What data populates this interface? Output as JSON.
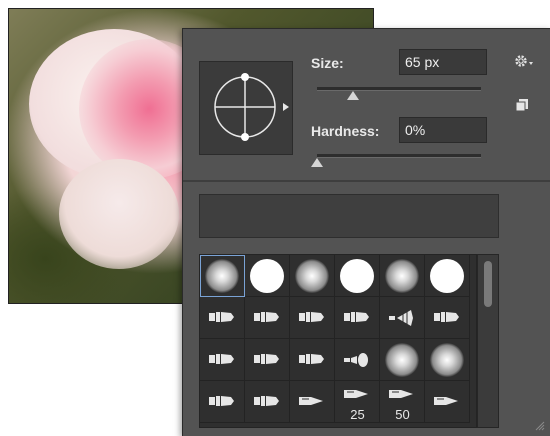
{
  "brush_panel": {
    "size_label": "Size:",
    "size_value": "65 px",
    "size_slider_fraction": 0.22,
    "hardness_label": "Hardness:",
    "hardness_value": "0%",
    "hardness_slider_fraction": 0.0,
    "icons": {
      "settings": "gear-icon",
      "new_preset": "new-preset-icon",
      "preview": "brush-tip-preview-icon",
      "resize": "resize-grip-icon"
    },
    "presets": {
      "rows": [
        [
          {
            "kind": "soft",
            "selected": true
          },
          {
            "kind": "hard"
          },
          {
            "kind": "soft"
          },
          {
            "kind": "hard"
          },
          {
            "kind": "soft"
          },
          {
            "kind": "hard"
          }
        ],
        [
          {
            "kind": "tip",
            "icon": "brush-tip-icon"
          },
          {
            "kind": "tip",
            "icon": "brush-tip-icon"
          },
          {
            "kind": "tip",
            "icon": "brush-tip-icon"
          },
          {
            "kind": "tip",
            "icon": "brush-tip-icon"
          },
          {
            "kind": "tip",
            "icon": "fan-brush-icon"
          },
          {
            "kind": "tip",
            "icon": "brush-tip-icon"
          }
        ],
        [
          {
            "kind": "tip",
            "icon": "brush-tip-icon"
          },
          {
            "kind": "tip",
            "icon": "brush-tip-icon"
          },
          {
            "kind": "tip",
            "icon": "brush-tip-icon"
          },
          {
            "kind": "tip",
            "icon": "round-brush-icon"
          },
          {
            "kind": "soft"
          },
          {
            "kind": "soft"
          }
        ],
        [
          {
            "kind": "tip",
            "icon": "brush-tip-icon"
          },
          {
            "kind": "tip",
            "icon": "brush-tip-icon"
          },
          {
            "kind": "tip",
            "icon": "pencil-tip-icon"
          },
          {
            "kind": "tip",
            "icon": "pencil-tip-icon",
            "label": "25"
          },
          {
            "kind": "tip",
            "icon": "pencil-tip-icon",
            "label": "50"
          },
          {
            "kind": "tip",
            "icon": "pencil-tip-icon"
          }
        ]
      ]
    }
  }
}
